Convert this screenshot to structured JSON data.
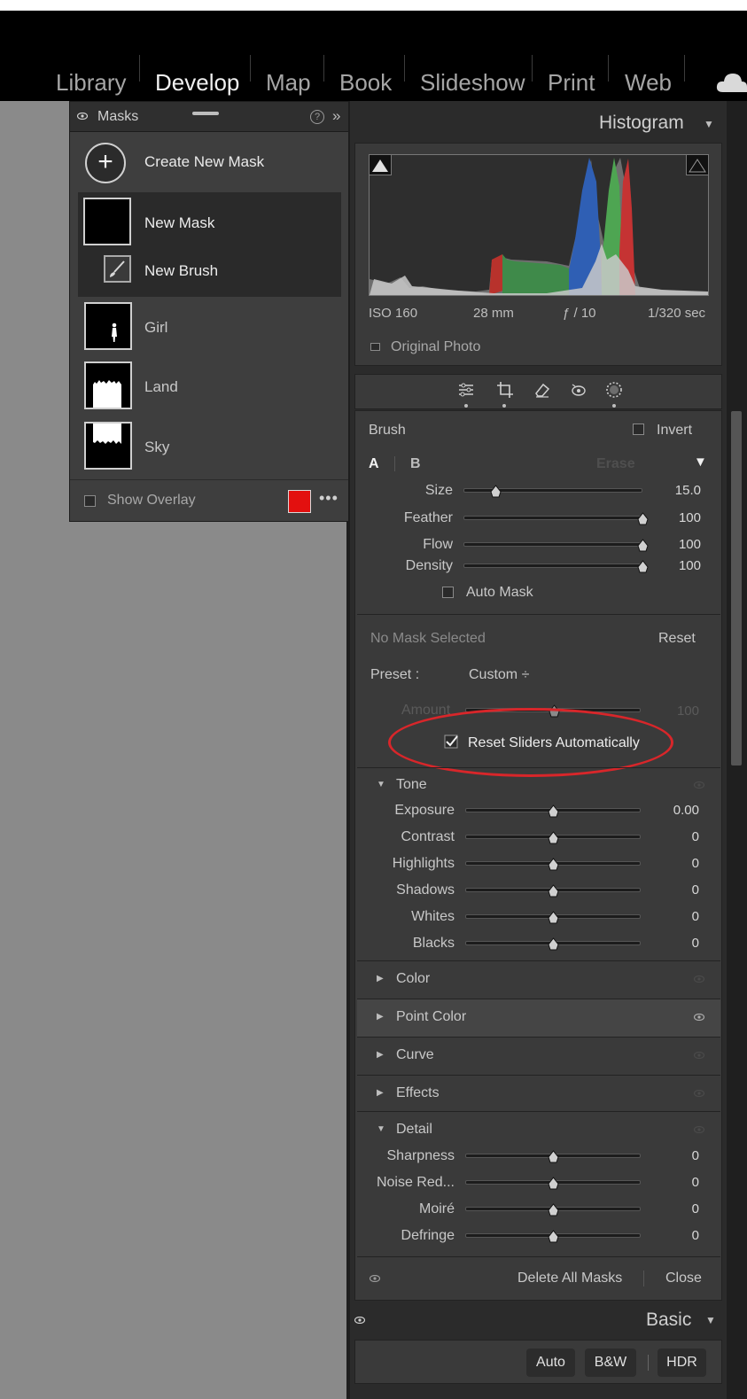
{
  "modules": [
    "Library",
    "Develop",
    "Map",
    "Book",
    "Slideshow",
    "Print",
    "Web"
  ],
  "active_module": "Develop",
  "masks_panel": {
    "title": "Masks",
    "create_label": "Create New Mask",
    "new_mask_label": "New Mask",
    "new_brush_label": "New Brush",
    "masks": [
      "Girl",
      "Land",
      "Sky"
    ],
    "show_overlay_label": "Show Overlay",
    "overlay_color": "#e3100f",
    "help_glyph": "?",
    "collapse_glyph": "»",
    "more_glyph": "•••"
  },
  "histogram": {
    "title": "Histogram",
    "iso": "ISO 160",
    "focal": "28 mm",
    "aperture": "ƒ / 10",
    "shutter": "1/320 sec",
    "original_photo_label": "Original Photo"
  },
  "brush": {
    "title": "Brush",
    "invert_label": "Invert",
    "tab_a": "A",
    "tab_b": "B",
    "erase_label": "Erase",
    "sliders": [
      {
        "label": "Size",
        "value": "15.0",
        "fraction": 0.18
      },
      {
        "label": "Feather",
        "value": "100",
        "fraction": 1.0
      },
      {
        "label": "Flow",
        "value": "100",
        "fraction": 1.0
      },
      {
        "label": "Density",
        "value": "100",
        "fraction": 1.0
      }
    ],
    "auto_mask_label": "Auto Mask"
  },
  "adjust": {
    "no_mask_label": "No Mask Selected",
    "reset_label": "Reset",
    "preset_label": "Preset :",
    "preset_value": "Custom ÷",
    "amount_label": "Amount",
    "amount_value": "100",
    "reset_sliders_label": "Reset Sliders Automatically",
    "reset_sliders_checked": true
  },
  "tone": {
    "title": "Tone",
    "sliders": [
      {
        "label": "Exposure",
        "value": "0.00"
      },
      {
        "label": "Contrast",
        "value": "0"
      },
      {
        "label": "Highlights",
        "value": "0"
      },
      {
        "label": "Shadows",
        "value": "0"
      },
      {
        "label": "Whites",
        "value": "0"
      },
      {
        "label": "Blacks",
        "value": "0"
      }
    ]
  },
  "sections": [
    "Color",
    "Point Color",
    "Curve",
    "Effects"
  ],
  "detail": {
    "title": "Detail",
    "sliders": [
      {
        "label": "Sharpness",
        "value": "0"
      },
      {
        "label": "Noise Red...",
        "value": "0"
      },
      {
        "label": "Moiré",
        "value": "0"
      },
      {
        "label": "Defringe",
        "value": "0"
      }
    ]
  },
  "footer": {
    "delete_all_label": "Delete All Masks",
    "close_label": "Close"
  },
  "basic": {
    "title": "Basic",
    "auto_label": "Auto",
    "bw_label": "B&W",
    "hdr_label": "HDR"
  },
  "colors": {
    "annotation_ellipse": "#d8262a",
    "panel_bg": "#3a3a3a"
  }
}
